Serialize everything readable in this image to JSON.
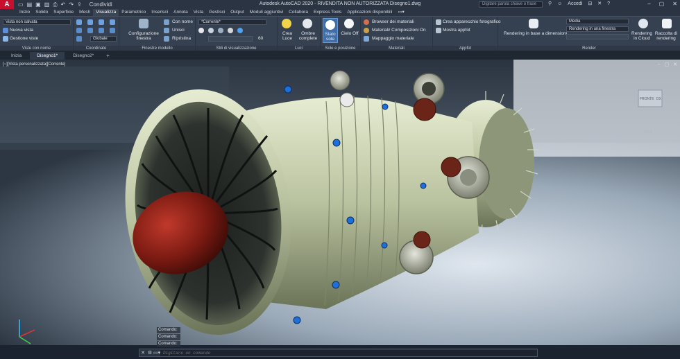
{
  "title": {
    "logo": "A",
    "text": "Autodesk AutoCAD 2020 - RIVENDITA NON AUTORIZZATA    Disegno1.dwg",
    "share": "Condividi",
    "search_placeholder": "Digitare parola chiave o frase",
    "signin": "Accedi"
  },
  "tabs": [
    "Inizio",
    "Solido",
    "Superficie",
    "Mesh",
    "Visualizza",
    "Parametrico",
    "Inserisci",
    "Annota",
    "Vista",
    "Gestisci",
    "Output",
    "Moduli aggiuntivi",
    "Collabora",
    "Express Tools",
    "Applicazioni disponibili"
  ],
  "ribbon": {
    "views": {
      "current": "Vista non salvata",
      "new": "Nuova vista",
      "manage": "Gestione viste",
      "label": "Viste con nome"
    },
    "coords": {
      "ucs": "Globale",
      "label": "Coordinate"
    },
    "model": {
      "config": "Configurazione finestra",
      "named": "Con nome",
      "join": "Unisci",
      "restore": "Ripristina",
      "label": "Finestre modello"
    },
    "styles": {
      "current": "*Corrente*",
      "opacity": "60",
      "label": "Stili di visualizzazione"
    },
    "lights": {
      "create": "Crea Luce",
      "shadows": "Ombre complete",
      "label": "Luci"
    },
    "sun": {
      "status": "Stato sole",
      "sky": "Cielo Off",
      "label": "Sole e posizione"
    },
    "materials": {
      "browser": "Browser dei materiali",
      "mat_on": "Materiali/ Composizioni On",
      "mapping": "Mappaggio materiale",
      "label": "Materiali"
    },
    "camera": {
      "create": "Crea apparecchio fotografico",
      "show": "Mostra appfot",
      "label": "Appfot"
    },
    "render": {
      "preset": "Media",
      "size": "Rendering in una finestra",
      "dims": "Rendering in base a dimensioni",
      "cloud": "Rendering in Cloud",
      "gallery": "Raccolta di rendering",
      "label": "Render"
    }
  },
  "doctabs": [
    "Inizia",
    "Disegno1*",
    "Disegno2*"
  ],
  "viewport": {
    "label": "[−][Vista personalizzata][Corrente]",
    "wcs": "WCS",
    "cube_front": "FRONTE",
    "cube_right": "DX"
  },
  "command": {
    "history": [
      "Comando:",
      "Comando:",
      "Comando:"
    ],
    "placeholder": "Digitare un comando"
  },
  "colors": {
    "accent": "#c8102e",
    "engine_body": "#cfd6b8",
    "spinner": "#8b1a12",
    "bolts": "#1f6fd8"
  }
}
